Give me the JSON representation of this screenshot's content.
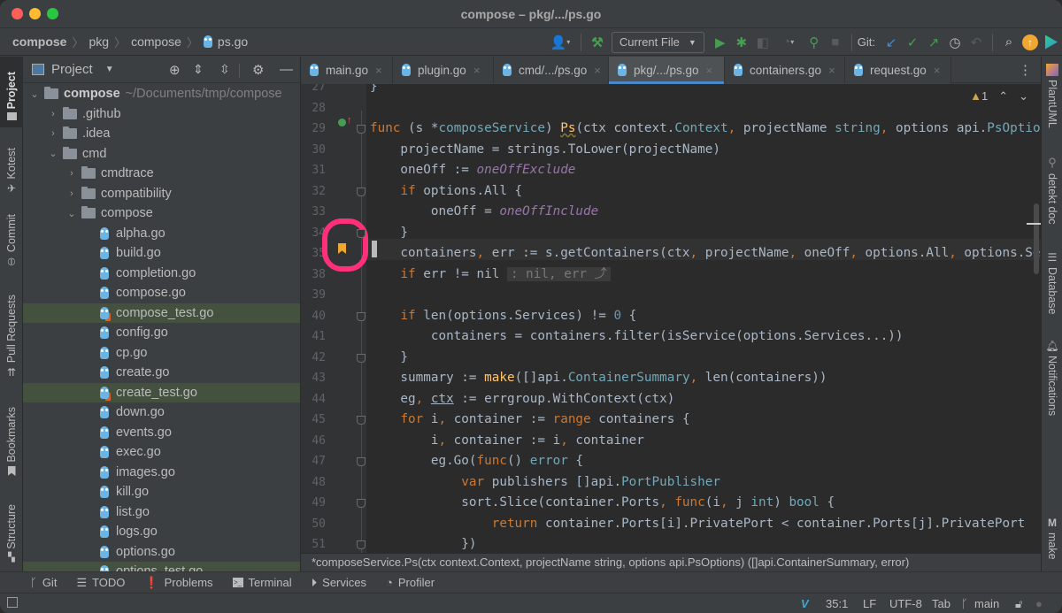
{
  "window": {
    "title": "compose – pkg/.../ps.go"
  },
  "breadcrumb": [
    "compose",
    "pkg",
    "compose",
    "ps.go"
  ],
  "toolbar": {
    "run_config": "Current File",
    "git_label": "Git:"
  },
  "left_tool_windows": [
    "Project",
    "Kotest",
    "Commit",
    "Pull Requests",
    "Bookmarks",
    "Structure"
  ],
  "right_tool_windows": [
    "PlantUML",
    "detekt doc",
    "Database",
    "Notifications",
    "make"
  ],
  "project_panel": {
    "title": "Project",
    "root": {
      "name": "compose",
      "path": "~/Documents/tmp/compose"
    },
    "tree": [
      {
        "name": ".github",
        "kind": "folder",
        "depth": 1,
        "expanded": false
      },
      {
        "name": ".idea",
        "kind": "folder",
        "depth": 1,
        "expanded": false
      },
      {
        "name": "cmd",
        "kind": "folder",
        "depth": 1,
        "expanded": true
      },
      {
        "name": "cmdtrace",
        "kind": "folder",
        "depth": 2,
        "expanded": false
      },
      {
        "name": "compatibility",
        "kind": "folder",
        "depth": 2,
        "expanded": false
      },
      {
        "name": "compose",
        "kind": "folder",
        "depth": 2,
        "expanded": true
      },
      {
        "name": "alpha.go",
        "kind": "go",
        "depth": 3
      },
      {
        "name": "build.go",
        "kind": "go",
        "depth": 3
      },
      {
        "name": "completion.go",
        "kind": "go",
        "depth": 3
      },
      {
        "name": "compose.go",
        "kind": "go",
        "depth": 3
      },
      {
        "name": "compose_test.go",
        "kind": "gotest",
        "depth": 3,
        "highlight": true
      },
      {
        "name": "config.go",
        "kind": "go",
        "depth": 3
      },
      {
        "name": "cp.go",
        "kind": "go",
        "depth": 3
      },
      {
        "name": "create.go",
        "kind": "go",
        "depth": 3
      },
      {
        "name": "create_test.go",
        "kind": "gotest",
        "depth": 3,
        "highlight": true
      },
      {
        "name": "down.go",
        "kind": "go",
        "depth": 3
      },
      {
        "name": "events.go",
        "kind": "go",
        "depth": 3
      },
      {
        "name": "exec.go",
        "kind": "go",
        "depth": 3
      },
      {
        "name": "images.go",
        "kind": "go",
        "depth": 3
      },
      {
        "name": "kill.go",
        "kind": "go",
        "depth": 3
      },
      {
        "name": "list.go",
        "kind": "go",
        "depth": 3
      },
      {
        "name": "logs.go",
        "kind": "go",
        "depth": 3
      },
      {
        "name": "options.go",
        "kind": "go",
        "depth": 3
      },
      {
        "name": "options_test.go",
        "kind": "gotest",
        "depth": 3,
        "highlight": true
      }
    ]
  },
  "tabs": [
    {
      "label": "main.go",
      "active": false
    },
    {
      "label": "plugin.go",
      "active": false
    },
    {
      "label": "cmd/.../ps.go",
      "active": false
    },
    {
      "label": "pkg/.../ps.go",
      "active": true
    },
    {
      "label": "containers.go",
      "active": false
    },
    {
      "label": "request.go",
      "active": false
    }
  ],
  "editor": {
    "warnings_count": "1",
    "lines": [
      {
        "n": "27",
        "html": "}"
      },
      {
        "n": "28",
        "html": ""
      },
      {
        "n": "29",
        "html": "<span class=\"kw\">func</span> (s *<span class=\"tn\">composeService</span>) <span class=\"fn\" style=\"text-decoration:underline wavy #8a7a3a\">Ps</span>(ctx context.<span class=\"tn\">Context</span><span class=\"kw\">,</span> projectName <span class=\"tn\">string</span><span class=\"kw\">,</span> options api.<span class=\"tn\">PsOptions</span>) ([]api.<span class=\"tn\">ContainerSummary</span><span class=\"kw\">,</span> <span class=\"tn\">error</span>) {"
      },
      {
        "n": "30",
        "html": "    projectName = strings.ToLower(projectName)"
      },
      {
        "n": "31",
        "html": "    oneOff := <span class=\"cn\">oneOffExclude</span>"
      },
      {
        "n": "32",
        "html": "    <span class=\"kw\">if</span> options.All {"
      },
      {
        "n": "33",
        "html": "        oneOff = <span class=\"cn\">oneOffInclude</span>"
      },
      {
        "n": "34",
        "html": "    }"
      },
      {
        "n": "35",
        "html": "    containers<span class=\"kw\">,</span> err := s.getContainers(ctx<span class=\"kw\">,</span> projectName<span class=\"kw\">,</span> oneOff<span class=\"kw\">,</span> options.All<span class=\"kw\">,</span> options.Services...)"
      },
      {
        "n": "38",
        "html": "    <span class=\"kw\">if</span> err != nil <span class=\"hint\">: nil, err ⤴</span>"
      },
      {
        "n": "39",
        "html": ""
      },
      {
        "n": "40",
        "html": "    <span class=\"kw\">if</span> len(options.Services) != <span class=\"num\">0</span> {"
      },
      {
        "n": "41",
        "html": "        containers = containers.filter(isService(options.Services...))"
      },
      {
        "n": "42",
        "html": "    }"
      },
      {
        "n": "43",
        "html": "    summary := <span class=\"fn\">make</span>([]api.<span class=\"tn\">ContainerSummary</span><span class=\"kw\">,</span> len(containers))"
      },
      {
        "n": "44",
        "html": "    eg<span class=\"kw\">,</span> <span style=\"text-decoration:underline\">ctx</span> := errgroup.WithContext(ctx)"
      },
      {
        "n": "45",
        "html": "    <span class=\"kw\">for</span> i<span class=\"kw\">,</span> container := <span class=\"kw\">range</span> containers {"
      },
      {
        "n": "46",
        "html": "        i<span class=\"kw\">,</span> container := i<span class=\"kw\">,</span> container"
      },
      {
        "n": "47",
        "html": "        eg.Go(<span class=\"kw\">func</span>() <span class=\"tn\">error</span> {"
      },
      {
        "n": "48",
        "html": "            <span class=\"kw\">var</span> publishers []api.<span class=\"tn\">PortPublisher</span>"
      },
      {
        "n": "49",
        "html": "            sort.Slice(container.Ports<span class=\"kw\">,</span> <span class=\"kw\">func</span>(i<span class=\"kw\">,</span> j <span class=\"tn\">int</span>) <span class=\"tn\">bool</span> {"
      },
      {
        "n": "50",
        "html": "                <span class=\"kw\">return</span> container.Ports[i].PrivatePort &lt; container.Ports[j].PrivatePort"
      },
      {
        "n": "51",
        "html": "            })"
      }
    ]
  },
  "doc_hint": "*composeService.Ps(ctx context.Context, projectName string, options api.PsOptions) ([]api.ContainerSummary, error)",
  "bottom_tools": [
    "Git",
    "TODO",
    "Problems",
    "Terminal",
    "Services",
    "Profiler"
  ],
  "status": {
    "position": "35:1",
    "line_ending": "LF",
    "encoding": "UTF-8",
    "indent": "Tab",
    "branch": "main"
  },
  "colors": {
    "accent": "#4a88c7",
    "bookmark": "#f0a732",
    "annotation_ring": "#ff2f79",
    "run_green": "#499c54"
  }
}
